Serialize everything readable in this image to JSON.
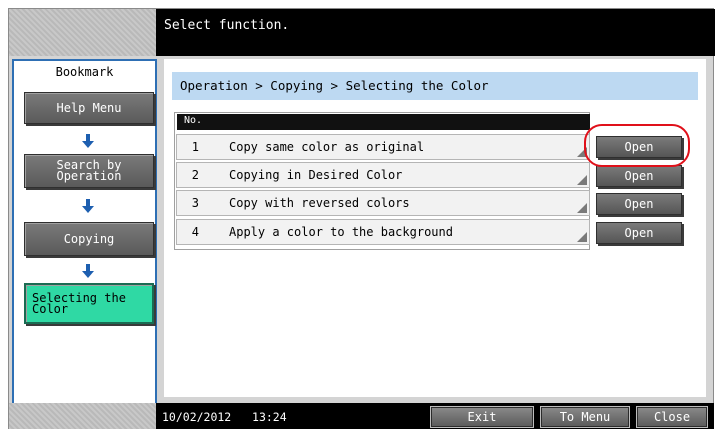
{
  "header": {
    "message": "Select function."
  },
  "bookmark": {
    "title": "Bookmark",
    "items": [
      {
        "label": "Help Menu"
      },
      {
        "label": "Search by Operation"
      },
      {
        "label": "Copying"
      },
      {
        "label": "Selecting the Color"
      }
    ]
  },
  "main": {
    "breadcrumb": "Operation > Copying > Selecting the Color",
    "list_header": "No.",
    "rows": [
      {
        "num": "1",
        "text": "Copy same color as original",
        "button": "Open"
      },
      {
        "num": "2",
        "text": "Copying in Desired Color",
        "button": "Open"
      },
      {
        "num": "3",
        "text": "Copy with reversed colors",
        "button": "Open"
      },
      {
        "num": "4",
        "text": "Apply a color to the background",
        "button": "Open"
      }
    ]
  },
  "footer": {
    "date": "10/02/2012",
    "time": "13:24",
    "exit_label": "Exit",
    "to_menu_label": "To Menu",
    "close_label": "Close"
  },
  "colors": {
    "accent_blue": "#2e6fb4",
    "active_green": "#2fd9a4",
    "highlight_red": "#e0101a",
    "breadcrumb_bg": "#bdd9f2"
  }
}
